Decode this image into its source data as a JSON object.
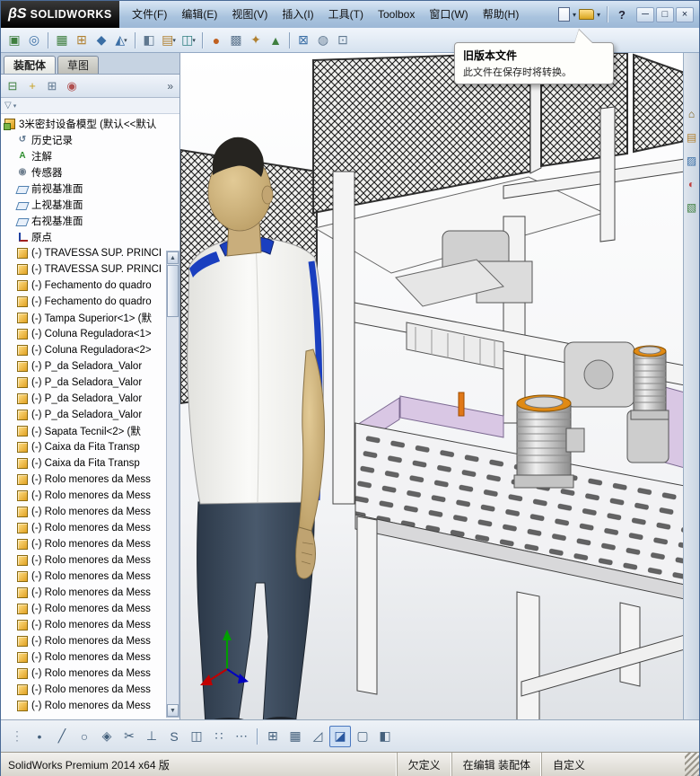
{
  "glyphs": {
    "caret": "▾",
    "chevrons": "»",
    "up_arrow": "▲",
    "down_arrow": "▼",
    "help": "?",
    "funnel": "▽"
  },
  "colors": {
    "titlebar_blue": "#a9c3de",
    "accent_orange": "#e88c1a",
    "lavender": "#d9c7e4",
    "skin": "#cdb183",
    "shirt": "#f5f5f3",
    "pants": "#3e4d5e",
    "mesh_dark": "#1c1c1c",
    "tree_component_gold": "#e0a020",
    "frame_white": "#f4f4f4"
  },
  "titlebar": {
    "logo_beta": "βS",
    "logo_text": "SOLIDWORKS",
    "menus": [
      {
        "name": "menu-file",
        "label": "文件(F)"
      },
      {
        "name": "menu-edit",
        "label": "编辑(E)"
      },
      {
        "name": "menu-view",
        "label": "视图(V)"
      },
      {
        "name": "menu-insert",
        "label": "插入(I)"
      },
      {
        "name": "menu-tools",
        "label": "工具(T)"
      },
      {
        "name": "menu-toolbox",
        "label": "Toolbox"
      },
      {
        "name": "menu-window",
        "label": "窗口(W)"
      },
      {
        "name": "menu-help",
        "label": "帮助(H)"
      }
    ],
    "file_icons": [
      {
        "name": "new-document-icon",
        "type": "doc"
      },
      {
        "name": "new-document-caret",
        "type": "caret"
      },
      {
        "name": "open-document-icon",
        "type": "folder"
      },
      {
        "name": "open-document-caret",
        "type": "caret"
      },
      {
        "name": "titlebar-separator",
        "type": "sep"
      },
      {
        "name": "help-icon",
        "type": "help"
      }
    ],
    "window_buttons": [
      {
        "name": "minimize-button",
        "glyph": "─"
      },
      {
        "name": "maximize-button",
        "glyph": "□"
      },
      {
        "name": "close-button",
        "glyph": "×"
      }
    ]
  },
  "toolbar_main": {
    "icons": [
      {
        "name": "insert-components-icon",
        "glyph": "▣",
        "fg": "#3f7f3f"
      },
      {
        "name": "mate-icon",
        "glyph": "◎",
        "fg": "#3a6ea5"
      },
      {
        "sep": true
      },
      {
        "name": "linear-component-pattern-icon",
        "glyph": "▦",
        "fg": "#3f7f3f"
      },
      {
        "name": "smart-fasteners-icon",
        "glyph": "⊞",
        "fg": "#b08030"
      },
      {
        "name": "move-component-icon",
        "glyph": "◆",
        "fg": "#3a6ea5"
      },
      {
        "name": "rotate-component-icon",
        "glyph": "◭",
        "fg": "#3a6ea5",
        "caret": true
      },
      {
        "sep": true
      },
      {
        "name": "show-hidden-components-icon",
        "glyph": "◧",
        "fg": "#607890"
      },
      {
        "name": "assembly-features-icon",
        "glyph": "▤",
        "fg": "#b08030",
        "caret": true
      },
      {
        "name": "reference-geometry-icon",
        "glyph": "◫",
        "fg": "#2f7f7f",
        "caret": true
      },
      {
        "sep": true
      },
      {
        "name": "new-motion-study-icon",
        "glyph": "●",
        "fg": "#c06020"
      },
      {
        "name": "bill-of-materials-icon",
        "glyph": "▩",
        "fg": "#607890"
      },
      {
        "name": "exploded-view-icon",
        "glyph": "✦",
        "fg": "#b08030"
      },
      {
        "name": "instant3d-icon",
        "glyph": "▲",
        "fg": "#3f7f3f"
      },
      {
        "sep": true
      },
      {
        "name": "interference-detection-icon",
        "glyph": "⊠",
        "fg": "#3a6ea5"
      },
      {
        "name": "measure-icon",
        "glyph": "◍",
        "fg": "#607890"
      },
      {
        "name": "mass-properties-icon",
        "glyph": "⊡",
        "fg": "#607890"
      }
    ]
  },
  "tooltip": {
    "title": "旧版本文件",
    "body": "此文件在保存时将转换。"
  },
  "panel": {
    "tabs": [
      {
        "name": "tab-assembly",
        "label": "装配体",
        "active": true
      },
      {
        "name": "tab-sketch",
        "label": "草图",
        "active": false
      }
    ],
    "header_icons": [
      {
        "name": "featuremanager-tree-icon",
        "glyph": "⊟",
        "fg": "#3f7f3f"
      },
      {
        "name": "propertymanager-icon",
        "glyph": "+",
        "fg": "#c8a020"
      },
      {
        "name": "configurationmanager-icon",
        "glyph": "⊞",
        "fg": "#607890"
      },
      {
        "name": "displaymanager-icon",
        "glyph": "◉",
        "fg": "#b05050"
      }
    ],
    "tree": {
      "root": {
        "kind": "asm-root",
        "label": "3米密封设备模型 (默认<<默认"
      },
      "items": [
        {
          "kind": "history",
          "glyph": "↺",
          "fg": "#607890",
          "label": "历史记录"
        },
        {
          "kind": "annotations",
          "glyph": "A",
          "fg": "#2f8f2f",
          "label": "注解"
        },
        {
          "kind": "sensors",
          "glyph": "◉",
          "fg": "#708090",
          "label": "传感器"
        },
        {
          "kind": "plane",
          "label": "前视基准面"
        },
        {
          "kind": "plane",
          "label": "上视基准面"
        },
        {
          "kind": "plane",
          "label": "右视基准面"
        },
        {
          "kind": "origin",
          "label": "原点"
        },
        {
          "kind": "component",
          "label": "(-) TRAVESSA SUP. PRINCI"
        },
        {
          "kind": "component",
          "label": "(-) TRAVESSA SUP. PRINCI"
        },
        {
          "kind": "component",
          "label": "(-) Fechamento do quadro"
        },
        {
          "kind": "component",
          "label": "(-) Fechamento do quadro"
        },
        {
          "kind": "component",
          "label": "(-) Tampa Superior<1> (默"
        },
        {
          "kind": "component",
          "label": "(-) Coluna Reguladora<1>"
        },
        {
          "kind": "component",
          "label": "(-) Coluna Reguladora<2>"
        },
        {
          "kind": "component",
          "label": "(-) P_da Seladora_Valor"
        },
        {
          "kind": "component",
          "label": "(-) P_da Seladora_Valor"
        },
        {
          "kind": "component",
          "label": "(-) P_da Seladora_Valor"
        },
        {
          "kind": "component",
          "label": "(-) P_da Seladora_Valor"
        },
        {
          "kind": "component",
          "label": "(-) Sapata Tecnil<2> (默"
        },
        {
          "kind": "component",
          "label": "(-) Caixa da Fita Transp"
        },
        {
          "kind": "component",
          "label": "(-) Caixa da Fita Transp"
        },
        {
          "kind": "component",
          "label": "(-) Rolo menores da Mess"
        },
        {
          "kind": "component",
          "label": "(-) Rolo menores da Mess"
        },
        {
          "kind": "component",
          "label": "(-) Rolo menores da Mess"
        },
        {
          "kind": "component",
          "label": "(-) Rolo menores da Mess"
        },
        {
          "kind": "component",
          "label": "(-) Rolo menores da Mess"
        },
        {
          "kind": "component",
          "label": "(-) Rolo menores da Mess"
        },
        {
          "kind": "component",
          "label": "(-) Rolo menores da Mess"
        },
        {
          "kind": "component",
          "label": "(-) Rolo menores da Mess"
        },
        {
          "kind": "component",
          "label": "(-) Rolo menores da Mess"
        },
        {
          "kind": "component",
          "label": "(-) Rolo menores da Mess"
        },
        {
          "kind": "component",
          "label": "(-) Rolo menores da Mess"
        },
        {
          "kind": "component",
          "label": "(-) Rolo menores da Mess"
        },
        {
          "kind": "component",
          "label": "(-) Rolo menores da Mess"
        },
        {
          "kind": "component",
          "label": "(-) Rolo menores da Mess"
        },
        {
          "kind": "component",
          "label": "(-) Rolo menores da Mess"
        }
      ]
    }
  },
  "right_panel": {
    "icons": [
      {
        "name": "home-icon",
        "glyph": "⌂",
        "fg": "#7a5a10"
      },
      {
        "name": "design-library-icon",
        "glyph": "▤",
        "fg": "#b08030"
      },
      {
        "name": "file-explorer-icon",
        "glyph": "▨",
        "fg": "#3a6ea5"
      },
      {
        "name": "appearances-icon",
        "glyph": "◐",
        "fg": "#c04040"
      },
      {
        "name": "custom-properties-icon",
        "glyph": "▧",
        "fg": "#3f7f3f"
      }
    ]
  },
  "bottom_toolbar": {
    "icons": [
      {
        "name": "toolbar-grip-icon",
        "glyph": "⋮",
        "fg": "#8a98a8"
      },
      {
        "name": "point-icon",
        "glyph": "•",
        "fg": "#44607c"
      },
      {
        "name": "line-icon",
        "glyph": "╱",
        "fg": "#44607c"
      },
      {
        "name": "circle-icon",
        "glyph": "○",
        "fg": "#44607c"
      },
      {
        "name": "polygon-icon",
        "glyph": "◈",
        "fg": "#44607c"
      },
      {
        "name": "trim-entities-icon",
        "glyph": "✂",
        "fg": "#44607c"
      },
      {
        "name": "perpendicular-icon",
        "glyph": "⊥",
        "fg": "#44607c"
      },
      {
        "name": "spline-icon",
        "glyph": "S",
        "fg": "#44607c"
      },
      {
        "name": "mirror-entities-icon",
        "glyph": "◫",
        "fg": "#44607c"
      },
      {
        "name": "linear-sketch-pattern-icon",
        "glyph": "∷",
        "fg": "#44607c"
      },
      {
        "name": "more-tools-icon",
        "glyph": "⋯",
        "fg": "#44607c"
      },
      {
        "sep": true
      },
      {
        "name": "zoom-fit-icon",
        "glyph": "⊞",
        "fg": "#44607c"
      },
      {
        "name": "grid-icon",
        "glyph": "▦",
        "fg": "#44607c"
      },
      {
        "name": "ruler-icon",
        "glyph": "◿",
        "fg": "#44607c"
      },
      {
        "name": "shaded-with-edges-icon",
        "glyph": "◪",
        "fg": "#2a58a0",
        "active": true
      },
      {
        "name": "wireframe-icon",
        "glyph": "▢",
        "fg": "#44607c"
      },
      {
        "name": "section-view-icon",
        "glyph": "◧",
        "fg": "#44607c"
      }
    ]
  },
  "statusbar": {
    "left": "SolidWorks Premium 2014 x64 版",
    "fields": [
      {
        "name": "constraint-status",
        "label": "欠定义"
      },
      {
        "name": "edit-status",
        "label": "在编辑 装配体"
      },
      {
        "name": "custom-field",
        "label": "自定义",
        "wide": true
      }
    ]
  }
}
